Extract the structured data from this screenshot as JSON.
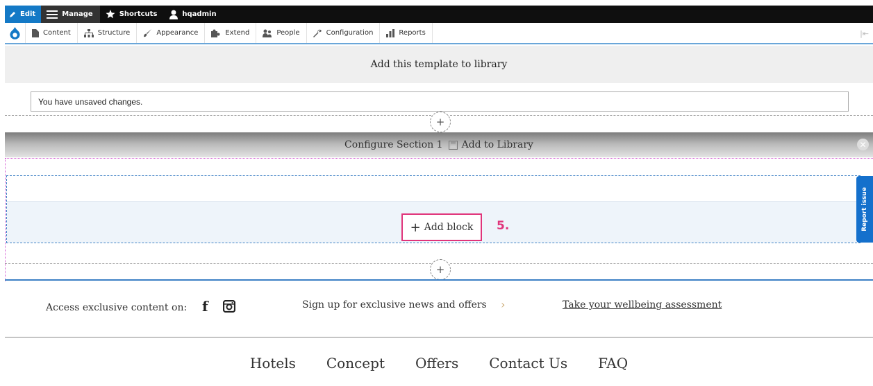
{
  "toolbar_top": {
    "edit_label": "Edit",
    "manage_label": "Manage",
    "shortcuts_label": "Shortcuts",
    "user_label": "hqadmin"
  },
  "admin_menu": {
    "items": [
      {
        "label": "Content",
        "icon": "document-icon"
      },
      {
        "label": "Structure",
        "icon": "sitemap-icon"
      },
      {
        "label": "Appearance",
        "icon": "paintbrush-icon"
      },
      {
        "label": "Extend",
        "icon": "puzzle-icon"
      },
      {
        "label": "People",
        "icon": "people-icon"
      },
      {
        "label": "Configuration",
        "icon": "wrench-icon"
      },
      {
        "label": "Reports",
        "icon": "bar-chart-icon"
      }
    ],
    "collapse_glyph": "|⇤"
  },
  "library_bar": {
    "label": "Add this template to library"
  },
  "status": {
    "unsaved": "You have unsaved changes."
  },
  "section": {
    "configure_label": "Configure Section 1",
    "add_to_library_label": "Add to Library",
    "add_section_glyph": "+",
    "close_glyph": "✕"
  },
  "block": {
    "add_block_label": "Add block",
    "add_glyph": "+",
    "step_marker": "5."
  },
  "report_issue": {
    "label": "Report issue"
  },
  "footer": {
    "access_text": "Access exclusive content on:",
    "facebook_glyph": "f",
    "signup_text": "Sign up for exclusive news and offers",
    "signup_arrow": "›",
    "wellbeing_link": "Take your wellbeing assessment",
    "nav": [
      "Hotels",
      "Concept",
      "Offers",
      "Contact Us",
      "FAQ"
    ]
  },
  "colors": {
    "toolbar_black": "#0f0f0f",
    "edit_blue": "#1479c6",
    "highlight_pink": "#e0347a",
    "region_blue": "#3b7fc4",
    "report_tab_blue": "#1470cc"
  }
}
